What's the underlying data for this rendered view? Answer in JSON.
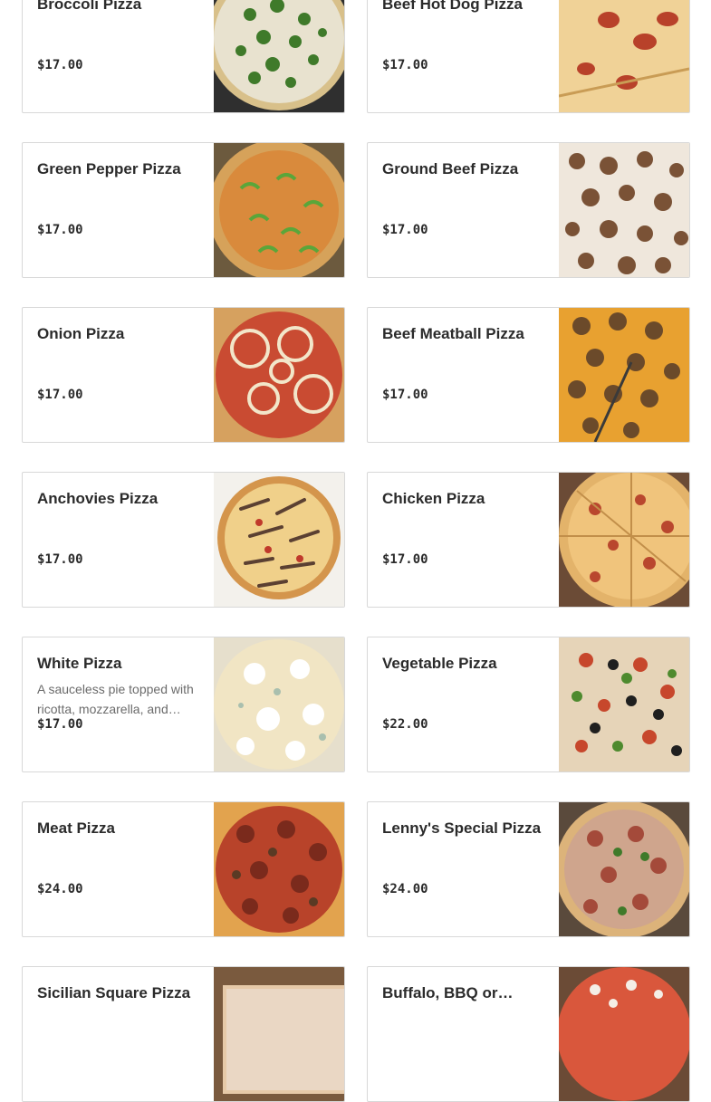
{
  "menu_items": [
    {
      "name": "Broccoli Pizza",
      "description": "",
      "price": "$17.00",
      "image": "broccoli-pizza-photo"
    },
    {
      "name": "Beef Hot Dog Pizza",
      "description": "",
      "price": "$17.00",
      "image": "hot-dog-pizza-photo"
    },
    {
      "name": "Green Pepper Pizza",
      "description": "",
      "price": "$17.00",
      "image": "green-pepper-pizza-photo"
    },
    {
      "name": "Ground Beef Pizza",
      "description": "",
      "price": "$17.00",
      "image": "ground-beef-pizza-photo"
    },
    {
      "name": "Onion Pizza",
      "description": "",
      "price": "$17.00",
      "image": "onion-pizza-photo"
    },
    {
      "name": "Beef Meatball Pizza",
      "description": "",
      "price": "$17.00",
      "image": "meatball-pizza-photo"
    },
    {
      "name": "Anchovies Pizza",
      "description": "",
      "price": "$17.00",
      "image": "anchovies-pizza-photo"
    },
    {
      "name": "Chicken Pizza",
      "description": "",
      "price": "$17.00",
      "image": "chicken-pizza-photo"
    },
    {
      "name": "White Pizza",
      "description": "A sauceless pie topped with ricotta, mozzarella, and…",
      "price": "$17.00",
      "image": "white-pizza-photo"
    },
    {
      "name": "Vegetable Pizza",
      "description": "",
      "price": "$22.00",
      "image": "vegetable-pizza-photo"
    },
    {
      "name": "Meat Pizza",
      "description": "",
      "price": "$24.00",
      "image": "meat-pizza-photo"
    },
    {
      "name": "Lenny's Special Pizza",
      "description": "",
      "price": "$24.00",
      "image": "special-pizza-photo"
    },
    {
      "name": "Sicilian Square Pizza",
      "description": "",
      "price": "",
      "image": "sicilian-pizza-photo"
    },
    {
      "name": "Buffalo, BBQ or…",
      "description": "",
      "price": "",
      "image": "buffalo-pizza-photo"
    }
  ]
}
